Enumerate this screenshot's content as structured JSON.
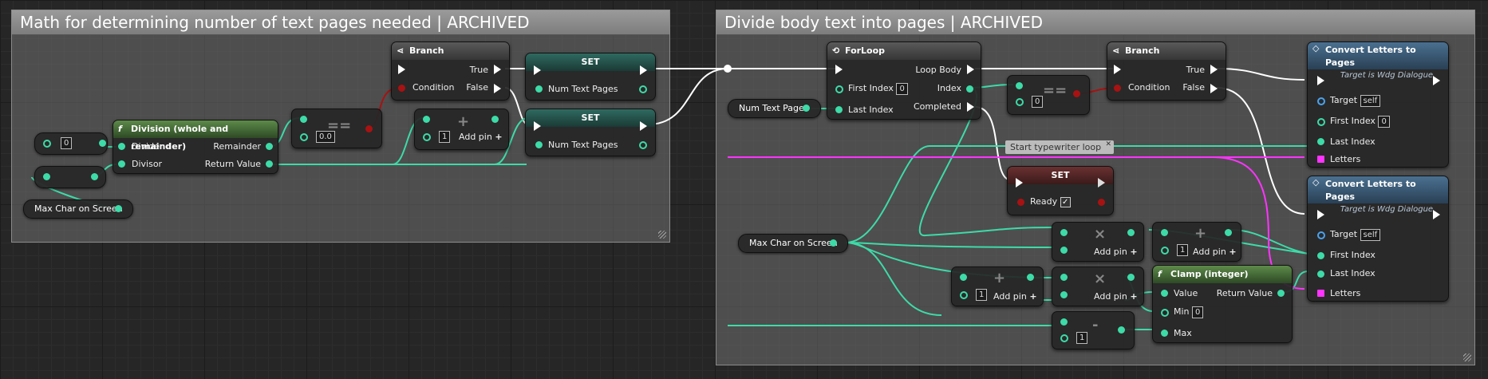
{
  "comments": {
    "left_title": "Math for determining number of text pages needed | ARCHIVED",
    "right_title": "Divide body text into pages | ARCHIVED"
  },
  "nodes": {
    "division": {
      "title": "Division (whole and remainder)",
      "dividend": "Dividend",
      "divisor": "Divisor",
      "remainder": "Remainder",
      "return_value": "Return Value"
    },
    "branch1": {
      "title": "Branch",
      "condition": "Condition",
      "true": "True",
      "false": "False"
    },
    "set1": {
      "title": "SET",
      "var": "Num Text Pages"
    },
    "set2": {
      "title": "SET",
      "var": "Num Text Pages"
    },
    "equal1": {
      "op": "==",
      "value": "0.0"
    },
    "add1": {
      "value": "1",
      "label": "Add pin"
    },
    "int_literal": {
      "value": "0"
    },
    "max_char_left": {
      "label": "Max Char on Screen"
    },
    "num_text_pages_get": {
      "label": "Num Text Pages"
    },
    "forloop": {
      "title": "ForLoop",
      "first_index": "First Index",
      "first_index_val": "0",
      "last_index": "Last Index",
      "loop_body": "Loop Body",
      "index": "Index",
      "completed": "Completed"
    },
    "equal2": {
      "op": "==",
      "value": "0"
    },
    "branch2": {
      "title": "Branch",
      "condition": "Condition",
      "true": "True",
      "false": "False"
    },
    "convert1": {
      "title": "Convert Letters to Pages",
      "subtitle": "Target is Wdg Dialogue",
      "target": "Target",
      "target_val": "self",
      "first_index": "First Index",
      "first_index_val": "0",
      "last_index": "Last Index",
      "letters": "Letters"
    },
    "convert2": {
      "title": "Convert Letters to Pages",
      "subtitle": "Target is Wdg Dialogue",
      "target": "Target",
      "target_val": "self",
      "first_index": "First Index",
      "last_index": "Last Index",
      "letters": "Letters"
    },
    "tooltip": {
      "text": "Start typewriter loop"
    },
    "set_ready": {
      "title": "SET",
      "var": "Ready",
      "checked": "✓"
    },
    "max_char_right": {
      "label": "Max Char on Screen"
    },
    "mul1": {
      "op": "×",
      "label": "Add pin"
    },
    "add2": {
      "value": "1",
      "label": "Add pin"
    },
    "add3": {
      "value": "1",
      "label": "Add pin"
    },
    "mul2": {
      "op": "×",
      "label": "Add pin"
    },
    "clamp": {
      "title": "Clamp (integer)",
      "value": "Value",
      "min": "Min",
      "min_val": "0",
      "max": "Max",
      "return_value": "Return Value"
    },
    "sub": {
      "value": "1",
      "op": "-"
    }
  },
  "colors": {
    "exec": "#ffffff",
    "int": "#3ddba8",
    "bool": "#a81212",
    "string_array": "#ff33ff",
    "object": "#49a3ee"
  }
}
